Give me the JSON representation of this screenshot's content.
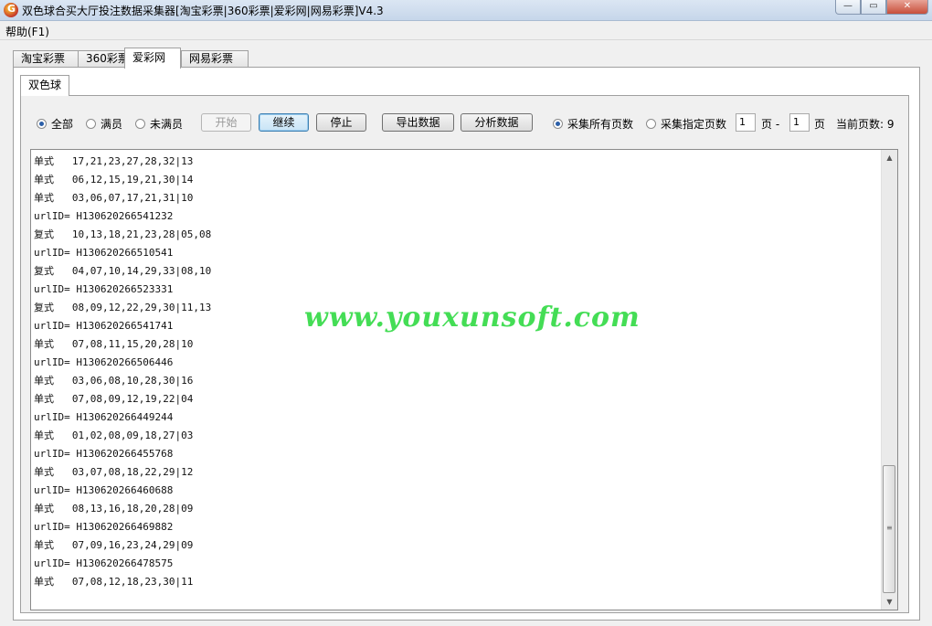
{
  "window": {
    "title": "双色球合买大厅投注数据采集器[淘宝彩票|360彩票|爱彩网|网易彩票]V4.3",
    "app_icon_letter": "G",
    "minimize_glyph": "—",
    "maximize_glyph": "▭",
    "close_glyph": "✕"
  },
  "menu": {
    "help": "帮助(F1)"
  },
  "outer_tabs": [
    {
      "label": "淘宝彩票",
      "active": false
    },
    {
      "label": "360彩票",
      "active": false
    },
    {
      "label": "爱彩网",
      "active": true
    },
    {
      "label": "网易彩票",
      "active": false
    }
  ],
  "inner_tabs": [
    {
      "label": "双色球",
      "active": true
    }
  ],
  "filters": {
    "all": "全部",
    "full": "满员",
    "not_full": "未满员",
    "selected": "all"
  },
  "buttons": {
    "start": "开始",
    "continue": "继续",
    "stop": "停止",
    "export": "导出数据",
    "analyze": "分析数据"
  },
  "pages": {
    "all_pages": "采集所有页数",
    "specified_pages": "采集指定页数",
    "selected": "all_pages",
    "from_value": "1",
    "separator": "页 -",
    "to_value": "1",
    "page_unit": "页",
    "current_label": "当前页数:",
    "current_value": "9"
  },
  "log_lines": [
    "单式   17,21,23,27,28,32|13",
    "单式   06,12,15,19,21,30|14",
    "单式   03,06,07,17,21,31|10",
    "urlID= H130620266541232",
    "复式   10,13,18,21,23,28|05,08",
    "urlID= H130620266510541",
    "复式   04,07,10,14,29,33|08,10",
    "urlID= H130620266523331",
    "复式   08,09,12,22,29,30|11,13",
    "urlID= H130620266541741",
    "单式   07,08,11,15,20,28|10",
    "urlID= H130620266506446",
    "单式   03,06,08,10,28,30|16",
    "单式   07,08,09,12,19,22|04",
    "urlID= H130620266449244",
    "单式   01,02,08,09,18,27|03",
    "urlID= H130620266455768",
    "单式   03,07,08,18,22,29|12",
    "urlID= H130620266460688",
    "单式   08,13,16,18,20,28|09",
    "urlID= H130620266469882",
    "单式   07,09,16,23,24,29|09",
    "urlID= H130620266478575",
    "单式   07,08,12,18,23,30|11"
  ],
  "watermark": "www.youxunsoft.com",
  "scrollbar": {
    "up_icon": "up-arrow-icon",
    "down_icon": "down-arrow-icon"
  }
}
